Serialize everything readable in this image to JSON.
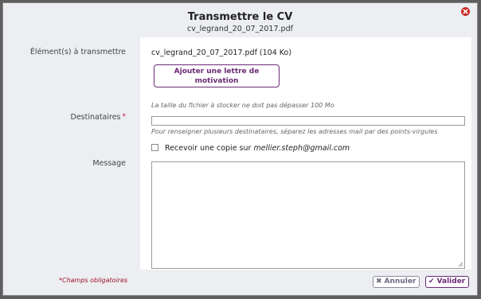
{
  "dialog": {
    "title": "Transmettre le CV",
    "subtitle": "cv_legrand_20_07_2017.pdf",
    "close_icon": "close-icon"
  },
  "form": {
    "elements_label": "Élément(s) à transmettre",
    "file_line": "cv_legrand_20_07_2017.pdf (104 Ko)",
    "motivation_button": "Ajouter une lettre de motivation",
    "size_hint": "La taille du fichier à stocker ne doit pas dépasser 100 Mo",
    "recipients_label": "Destinataires",
    "recipients_value": "",
    "recipients_hint": "Pour renseigner plusieurs destinataires, séparez les adresses mail par des points-virgules",
    "copy_label": "Recevoir une copie sur",
    "copy_email": "mellier.steph@gmail.com",
    "copy_checked": false,
    "message_label": "Message",
    "message_value": ""
  },
  "footer": {
    "required_note": "*Champs obligatoires",
    "cancel_label": "Annuler",
    "validate_label": "Valider"
  },
  "colors": {
    "accent": "#6b2a76",
    "required": "#c8102e",
    "dialog_bg": "#eceef1",
    "overlay": "#5e5e5e"
  }
}
